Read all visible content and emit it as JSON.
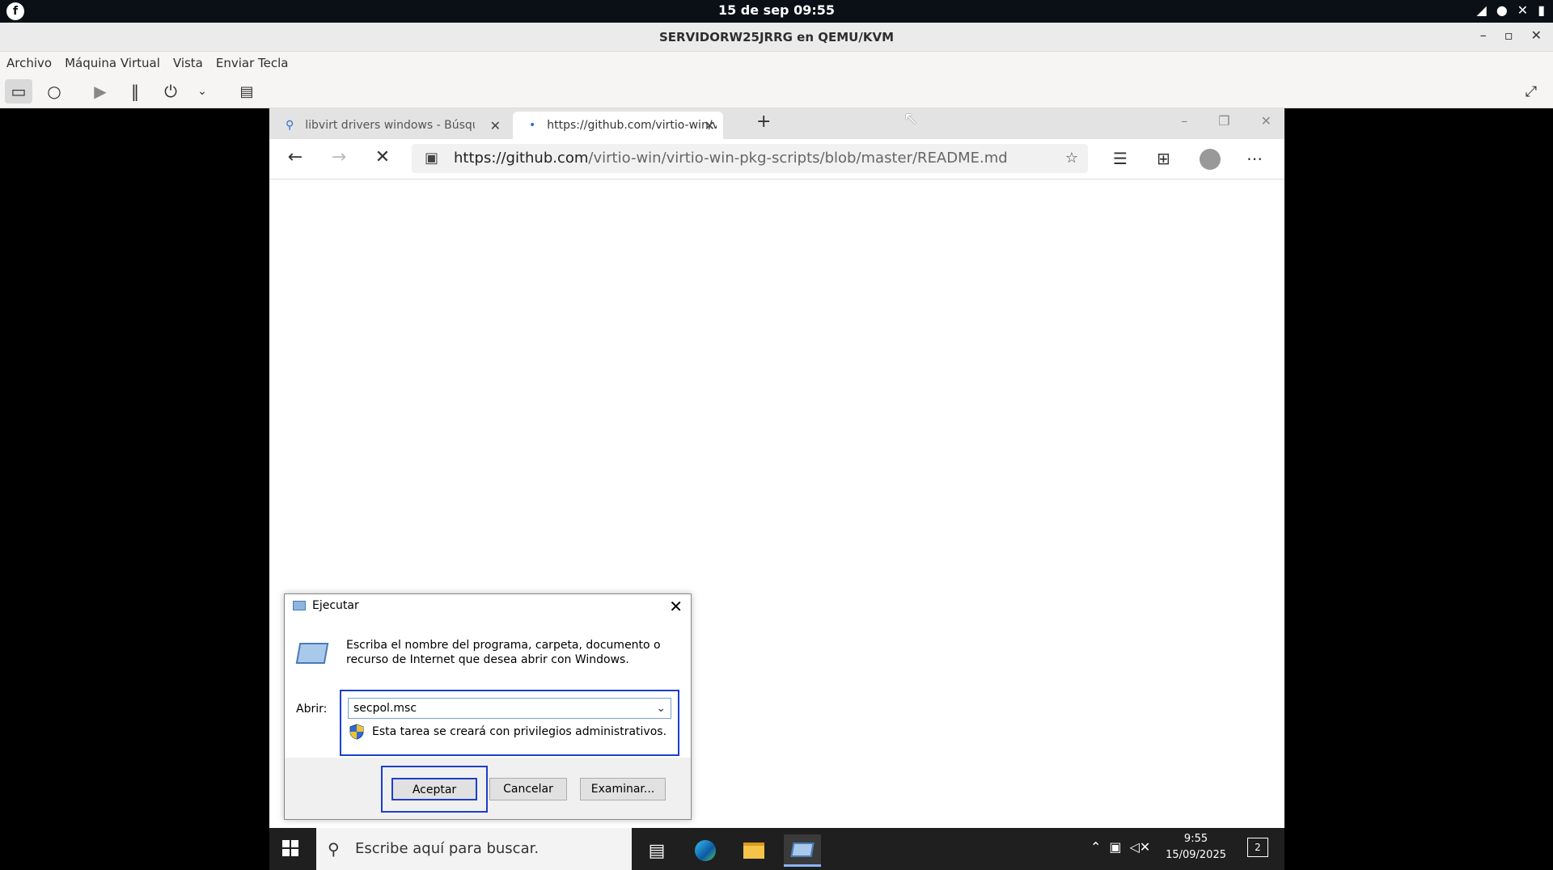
{
  "topbar": {
    "clock": "15 de sep  09:55",
    "logo_glyph": "f",
    "tray_icons": [
      "wifi-icon",
      "mic-icon",
      "speaker-muted-icon",
      "battery-icon"
    ]
  },
  "viewer": {
    "title": "SERVIDORW25JRRG en QEMU/KVM",
    "menu": [
      "Archivo",
      "Máquina Virtual",
      "Vista",
      "Enviar Tecla"
    ]
  },
  "edge": {
    "tabs": [
      {
        "label": "libvirt drivers windows - Búsqueda",
        "icon": "search-icon"
      },
      {
        "label": "https://github.com/virtio-win/virtio-win-pkg-scripts",
        "icon": "loading-icon"
      }
    ],
    "url_host": "https://github.com",
    "url_path": "/virtio-win/virtio-win-pkg-scripts/blob/master/README.md"
  },
  "run_dialog": {
    "title": "Ejecutar",
    "description_line1": "Escriba el nombre del programa, carpeta, documento o",
    "description_line2": "recurso de Internet que desea abrir con Windows.",
    "open_label": "Abrir:",
    "input_value": "secpol.msc",
    "admin_note": "Esta tarea se creará con privilegios administrativos.",
    "ok_label": "Aceptar",
    "cancel_label": "Cancelar",
    "browse_label": "Examinar..."
  },
  "taskbar": {
    "search_placeholder": "Escribe aquí para buscar.",
    "time": "9:55",
    "date": "15/09/2025",
    "notification_count": "2"
  },
  "colors": {
    "focus_blue": "#1e3fc8",
    "taskbar": "#1f1f1f"
  }
}
